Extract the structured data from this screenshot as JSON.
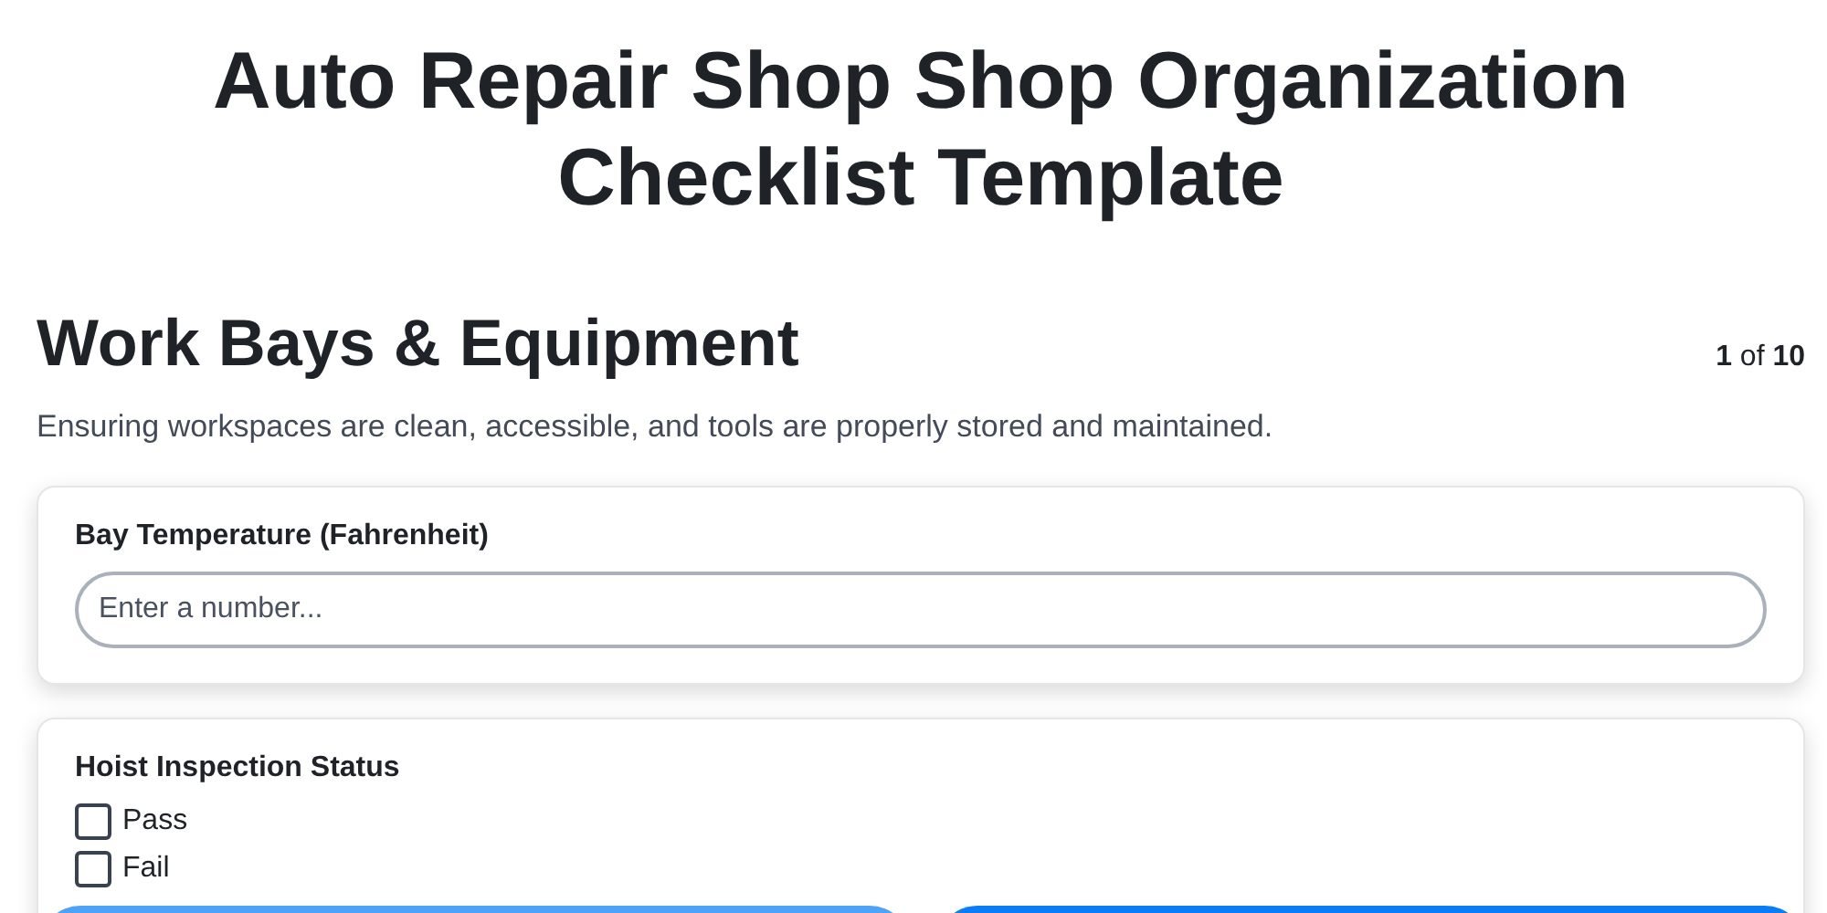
{
  "title": "Auto Repair Shop Shop Organization Checklist Template",
  "section": {
    "heading": "Work Bays & Equipment",
    "counter": "**1** of **10**",
    "description": "Ensuring workspaces are clean, accessible, and tools are properly stored and maintained."
  },
  "questions": [
    {
      "kind": "number",
      "label": "Bay Temperature (Fahrenheit)",
      "placeholder": "Enter a number..."
    },
    {
      "kind": "checkboxes",
      "label": "Hoist Inspection Status",
      "options": [
        {
          "label": "Pass",
          "checked": false
        },
        {
          "label": "Fail",
          "checked": false
        }
      ]
    }
  ],
  "nav_buttons": [
    {
      "kind": "secondary"
    },
    {
      "kind": "primary"
    }
  ]
}
